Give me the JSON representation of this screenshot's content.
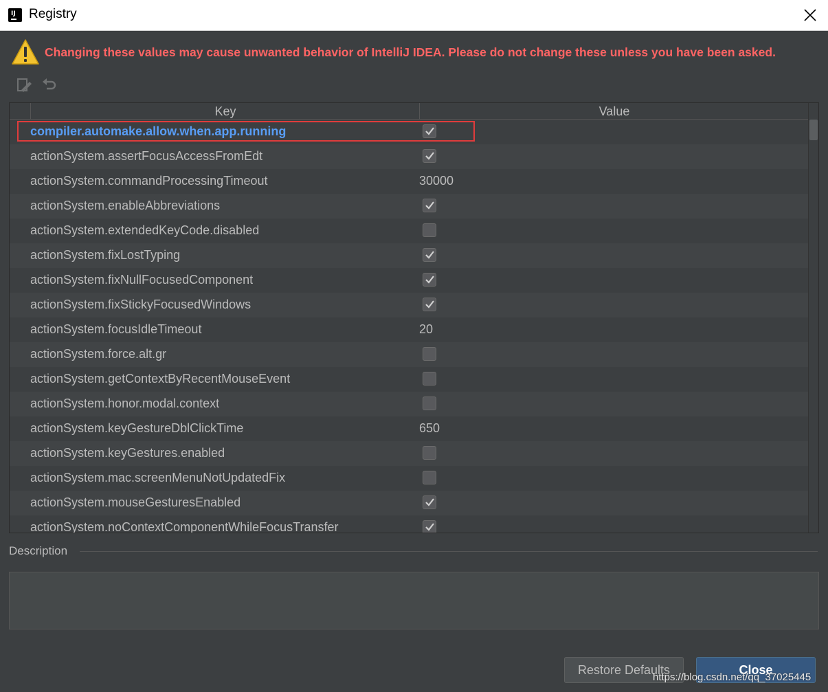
{
  "window": {
    "title": "Registry",
    "app_icon": "intellij-idea-icon",
    "close_icon": "close-icon"
  },
  "warning": {
    "icon": "warning-icon",
    "text": "Changing these values may cause unwanted behavior of IntelliJ IDEA. Please do not change these unless you have been asked.",
    "color": "#ff6464"
  },
  "toolbar": {
    "edit_icon": "edit-icon",
    "revert_icon": "revert-icon"
  },
  "table": {
    "columns": [
      "Key",
      "Value"
    ],
    "rows": [
      {
        "key": "compiler.automake.allow.when.app.running",
        "type": "checkbox",
        "checked": true,
        "selected": true
      },
      {
        "key": "actionSystem.assertFocusAccessFromEdt",
        "type": "checkbox",
        "checked": true
      },
      {
        "key": "actionSystem.commandProcessingTimeout",
        "type": "text",
        "value": "30000"
      },
      {
        "key": "actionSystem.enableAbbreviations",
        "type": "checkbox",
        "checked": true
      },
      {
        "key": "actionSystem.extendedKeyCode.disabled",
        "type": "checkbox",
        "checked": false
      },
      {
        "key": "actionSystem.fixLostTyping",
        "type": "checkbox",
        "checked": true
      },
      {
        "key": "actionSystem.fixNullFocusedComponent",
        "type": "checkbox",
        "checked": true
      },
      {
        "key": "actionSystem.fixStickyFocusedWindows",
        "type": "checkbox",
        "checked": true
      },
      {
        "key": "actionSystem.focusIdleTimeout",
        "type": "text",
        "value": "20"
      },
      {
        "key": "actionSystem.force.alt.gr",
        "type": "checkbox",
        "checked": false
      },
      {
        "key": "actionSystem.getContextByRecentMouseEvent",
        "type": "checkbox",
        "checked": false
      },
      {
        "key": "actionSystem.honor.modal.context",
        "type": "checkbox",
        "checked": false
      },
      {
        "key": "actionSystem.keyGestureDblClickTime",
        "type": "text",
        "value": "650"
      },
      {
        "key": "actionSystem.keyGestures.enabled",
        "type": "checkbox",
        "checked": false
      },
      {
        "key": "actionSystem.mac.screenMenuNotUpdatedFix",
        "type": "checkbox",
        "checked": false
      },
      {
        "key": "actionSystem.mouseGesturesEnabled",
        "type": "checkbox",
        "checked": true
      },
      {
        "key": "actionSystem.noContextComponentWhileFocusTransfer",
        "type": "checkbox",
        "checked": true
      }
    ]
  },
  "description": {
    "label": "Description",
    "text": ""
  },
  "buttons": {
    "restore": "Restore Defaults",
    "close": "Close"
  },
  "watermark": "https://blog.csdn.net/qq_37025445",
  "colors": {
    "background": "#3c3f41",
    "selected_key": "#589df6",
    "close_button": "#365880",
    "highlight_border": "#e03c3c"
  }
}
